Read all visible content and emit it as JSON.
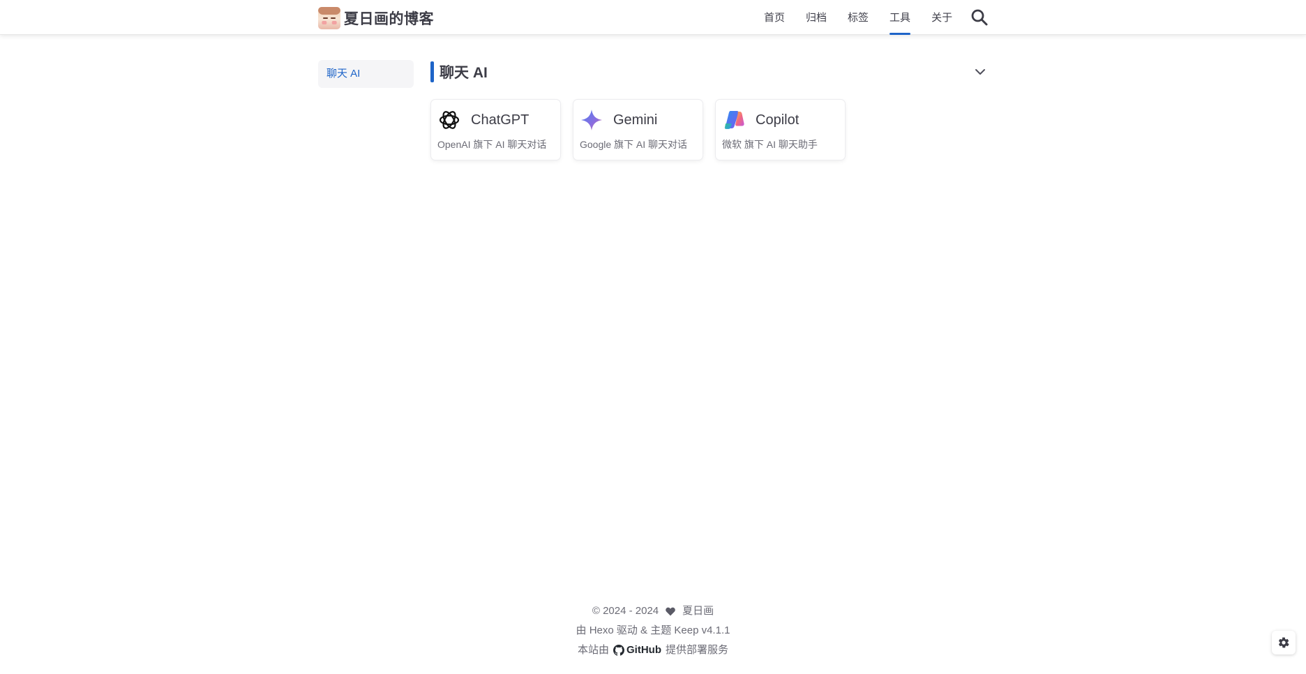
{
  "header": {
    "site_title": "夏日画的博客",
    "logo_icon": "anime-avatar-logo",
    "nav": [
      {
        "label": "首页",
        "active": false
      },
      {
        "label": "归档",
        "active": false
      },
      {
        "label": "标签",
        "active": false
      },
      {
        "label": "工具",
        "active": true
      },
      {
        "label": "关于",
        "active": false
      }
    ],
    "search_icon": "search-icon",
    "accent_color": "#1e64c8"
  },
  "sidebar": {
    "items": [
      {
        "label": "聊天 AI",
        "active": true
      }
    ]
  },
  "main": {
    "category_title": "聊天 AI",
    "collapse_icon": "chevron-down-icon",
    "cards": [
      {
        "name": "ChatGPT",
        "desc": "OpenAI 旗下 AI 聊天对话",
        "icon": "openai-icon"
      },
      {
        "name": "Gemini",
        "desc": "Google 旗下 AI 聊天对话",
        "icon": "gemini-sparkle-icon"
      },
      {
        "name": "Copilot",
        "desc": "微软 旗下 AI 聊天助手",
        "icon": "copilot-icon"
      }
    ]
  },
  "footer": {
    "copyright": "© 2024 - 2024",
    "author": "夏日画",
    "powered_by": "由 Hexo 驱动 & 主题 Keep v4.1.1",
    "deploy_prefix": "本站由",
    "deploy_brand": "GitHub",
    "deploy_suffix": "提供部署服务"
  },
  "settings_icon": "gear-icon"
}
